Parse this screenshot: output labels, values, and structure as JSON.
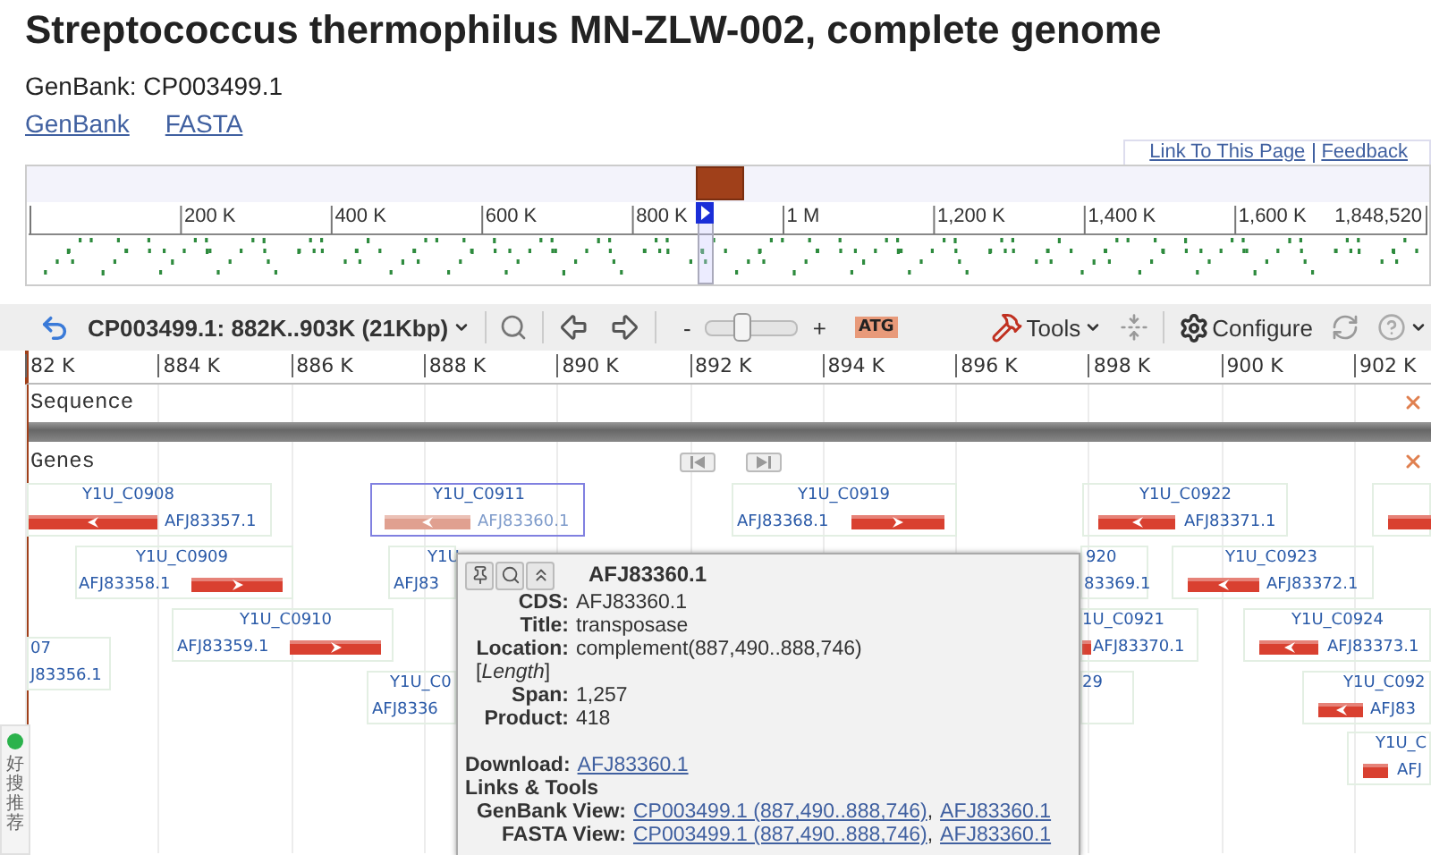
{
  "page": {
    "title": "Streptococcus thermophilus MN-ZLW-002, complete genome",
    "accession_line": "GenBank: CP003499.1",
    "links": [
      "GenBank",
      "FASTA"
    ],
    "page_links": [
      "Link To This Page",
      "Feedback"
    ]
  },
  "overview": {
    "tick_labels": [
      "200 K",
      "400 K",
      "600 K",
      "800 K",
      "1 M",
      "1,200 K",
      "1,400 K",
      "1,600 K",
      "1,848,520"
    ]
  },
  "toolbar": {
    "location": "CP003499.1: 882K..903K (21Kbp)",
    "zoom_out": "-",
    "zoom_slider": {
      "level": 0.4
    },
    "zoom_in": "+",
    "sequence_button": "ATG",
    "tools": "Tools",
    "configure": "Configure"
  },
  "ruler": {
    "tick_labels": [
      "82 K",
      "884 K",
      "886 K",
      "888 K",
      "890 K",
      "892 K",
      "894 K",
      "896 K",
      "898 K",
      "900 K",
      "902 K"
    ]
  },
  "tracks": [
    {
      "kind": "sequence",
      "label": "Sequence"
    },
    {
      "kind": "genes",
      "label": "Genes"
    }
  ],
  "genes": [
    {
      "label": "Y1U_C0908",
      "accession": "AFJ83357.1",
      "kind": "reverse",
      "selected": false
    },
    {
      "label": "Y1U_C0911",
      "accession": "AFJ83360.1",
      "kind": "reverse",
      "selected": true
    },
    {
      "label": "Y1U_C0919",
      "accession": "AFJ83368.1",
      "kind": "forward",
      "selected": false
    },
    {
      "label": "Y1U_C0922",
      "accession": "AFJ83371.1",
      "kind": "reverse",
      "selected": false
    },
    {
      "selected": false
    },
    {
      "label": "Y1U_C0909",
      "accession": "AFJ83358.1",
      "kind": "forward",
      "selected": false
    },
    {
      "label": "Y1U",
      "accession": "AFJ83",
      "selected": false
    },
    {
      "label": "Y1U_C0910",
      "accession": "AFJ83359.1",
      "kind": "forward",
      "selected": false
    },
    {
      "label": "07",
      "accession": "J83356.1",
      "selected": false
    },
    {
      "label": "Y1U_C0",
      "accession": "AFJ8336",
      "selected": false
    },
    {
      "label": "920",
      "accession": "83369.1",
      "selected": false
    },
    {
      "label": "1U_C0921",
      "accession": "AFJ83370.1",
      "selected": false
    },
    {
      "label": "29",
      "selected": false
    },
    {
      "label": "Y1U_C0923",
      "accession": "AFJ83372.1",
      "kind": "reverse",
      "selected": false
    },
    {
      "label": "Y1U_C0924",
      "accession": "AFJ83373.1",
      "kind": "reverse",
      "selected": false
    },
    {
      "label": "Y1U_C092",
      "accession": "AFJ83",
      "kind": "reverse",
      "selected": false
    },
    {
      "label": "Y1U_C",
      "accession": "AFJ",
      "selected": false
    }
  ],
  "popup": {
    "title": "AFJ83360.1",
    "fields": [
      {
        "label": "CDS:",
        "value": "AFJ83360.1"
      },
      {
        "label": "Title:",
        "value": "transposase"
      },
      {
        "label": "Location:",
        "value": "complement(887,490..888,746)"
      },
      {
        "note": "[*Length*]"
      },
      {
        "label": "Span:",
        "value": "1,257"
      },
      {
        "label": "Product:",
        "value": "418"
      }
    ],
    "download": {
      "label": "Download:",
      "link": "AFJ83360.1"
    },
    "links_heading": "Links & Tools",
    "views": [
      {
        "label": "GenBank View:",
        "separator": ",",
        "links": [
          "CP003499.1 (887,490..888,746)",
          "AFJ83360.1"
        ]
      },
      {
        "label": "FASTA View:",
        "separator": ",",
        "links": [
          "CP003499.1 (887,490..888,746)",
          "AFJ83360.1"
        ]
      }
    ]
  },
  "side_widget": {
    "text": "好搜推荐"
  }
}
